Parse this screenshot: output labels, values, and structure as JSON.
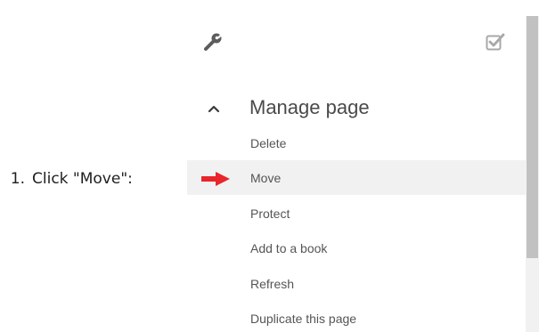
{
  "instruction": {
    "number": "1.",
    "text": "Click \"Move\":"
  },
  "toolbar": {
    "tools_icon": "wrench-icon",
    "select_icon": "checkbox-icon"
  },
  "section": {
    "title": "Manage page",
    "chevron_icon": "chevron-up-icon"
  },
  "menu": {
    "items": [
      {
        "label": "Delete"
      },
      {
        "label": "Move"
      },
      {
        "label": "Protect"
      },
      {
        "label": "Add to a book"
      },
      {
        "label": "Refresh"
      },
      {
        "label": "Duplicate this page"
      }
    ]
  },
  "colors": {
    "arrow": "#e8252b",
    "highlight": "#f1f1f1",
    "text": "#555555",
    "title": "#4a4a4a",
    "icon": "#5c5c5c"
  }
}
